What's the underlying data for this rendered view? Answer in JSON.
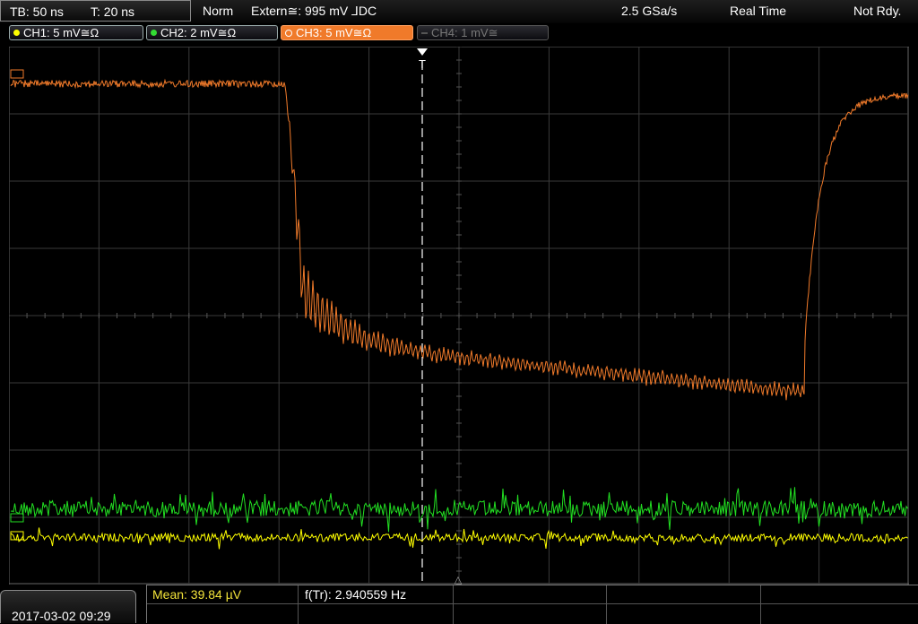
{
  "top": {
    "timebase": "TB: 50 ns",
    "trigger_pos": "T: 20 ns",
    "mode": "Norm",
    "trigger_source": "Extern≅: 995 mV ⅃DC",
    "sample_rate": "2.5 GSa/s",
    "acq_mode": "Real Time",
    "status": "Not Rdy."
  },
  "channels": [
    {
      "label": "CH1: 5 mV≅Ω",
      "color": "#ffff00",
      "state": "on"
    },
    {
      "label": "CH2: 2 mV≅Ω",
      "color": "#33dd33",
      "state": "on"
    },
    {
      "label": "CH3: 5 mV≅Ω",
      "color": "#f07a2a",
      "state": "active"
    },
    {
      "label": "CH4: 1 mV≅",
      "color": "#777777",
      "state": "off"
    }
  ],
  "markers": {
    "trigger_top": "T",
    "ref_bottom": "△"
  },
  "measurements": {
    "mean": "Mean: 39.84 µV",
    "freq": "f(Tr): 2.940559 Hz"
  },
  "datetime": "2017-03-02 09:29",
  "colors": {
    "ch1": "#ffff00",
    "ch2": "#22e022",
    "ch3": "#f07a2a",
    "grid": "#3a3a3a"
  },
  "chart_data": {
    "type": "line",
    "title": "",
    "xlabel": "",
    "ylabel": "",
    "grid": true,
    "divisions": {
      "x": 10,
      "y": 8
    },
    "series": [
      {
        "name": "CH3",
        "shape": "flat near +3.5 div until t≈-1.5 div, drops to band oscillating between about -0.7 and -3.5 div with slow downward drift, sharp rise at t≈+3.8 div back to about +3.2 div",
        "baseline_div": 3.5
      },
      {
        "name": "CH2",
        "shape": "noise around -2.9 div",
        "baseline_div": -2.9
      },
      {
        "name": "CH1",
        "shape": "noise around -3.3 div",
        "baseline_div": -3.3
      }
    ]
  }
}
